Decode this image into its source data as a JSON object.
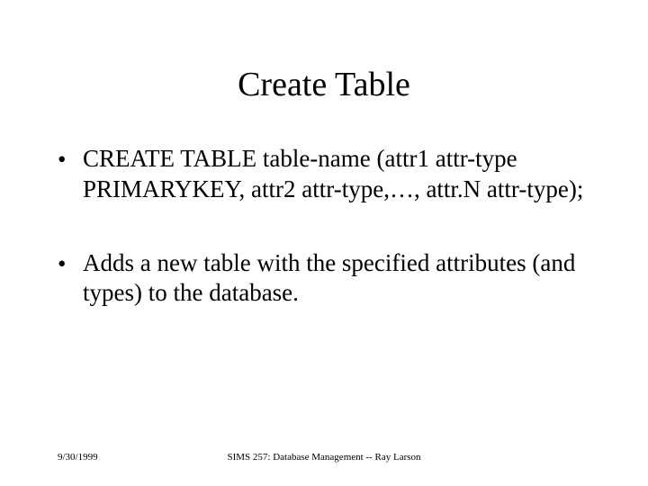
{
  "title": "Create Table",
  "bullets": [
    "CREATE TABLE table-name (attr1 attr-type PRIMARYKEY, attr2 attr-type,…, attr.N attr-type);",
    "Adds a new table with the specified attributes (and types) to the database."
  ],
  "footer": {
    "date": "9/30/1999",
    "course": "SIMS 257: Database Management -- Ray Larson"
  },
  "bullet_glyph": "•"
}
